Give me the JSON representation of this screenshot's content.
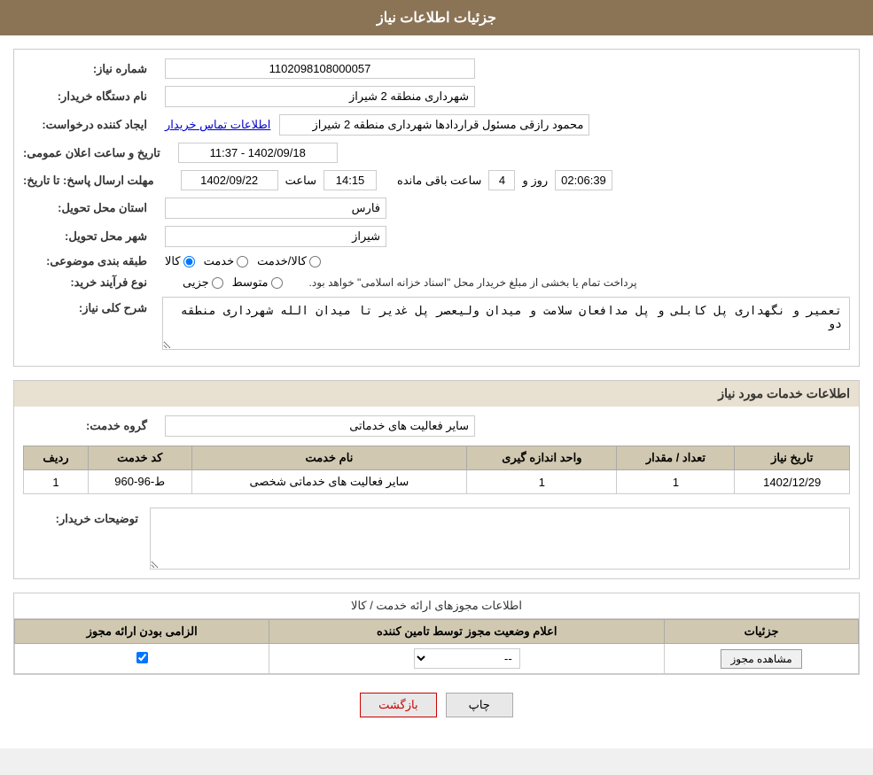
{
  "header": {
    "title": "جزئیات اطلاعات نیاز"
  },
  "labels": {
    "order_number": "شماره نیاز:",
    "buyer_org": "نام دستگاه خریدار:",
    "requester": "ایجاد کننده درخواست:",
    "response_deadline": "مهلت ارسال پاسخ: تا تاریخ:",
    "delivery_province": "استان محل تحویل:",
    "delivery_city": "شهر محل تحویل:",
    "category": "طبقه بندی موضوعی:",
    "purchase_type": "نوع فرآیند خرید:",
    "general_desc": "شرح کلی نیاز:",
    "service_info": "اطلاعات خدمات مورد نیاز",
    "service_group": "گروه خدمت:",
    "buyer_notes": "توضیحات خریدار:",
    "license_info": "اطلاعات مجوزهای ارائه خدمت / کالا",
    "contact_info": "اطلاعات تماس خریدار"
  },
  "values": {
    "order_number": "1102098108000057",
    "buyer_org": "شهرداری منطقه 2 شیراز",
    "requester": "محمود رازقی مسئول قراردادها شهرداری منطقه 2 شیراز",
    "announce_date_label": "تاریخ و ساعت اعلان عمومی:",
    "announce_date": "1402/09/18 - 11:37",
    "response_date": "1402/09/22",
    "response_time": "14:15",
    "response_days": "4",
    "response_hours": "02:06:39",
    "delivery_province": "فارس",
    "delivery_city": "شیراز",
    "category_goods": "کالا",
    "category_service": "خدمت",
    "category_goods_service": "کالا/خدمت",
    "purchase_partial": "جزیی",
    "purchase_medium": "متوسط",
    "purchase_note": "پرداخت تمام یا بخشی از مبلغ خریدار محل \"اسناد خزانه اسلامی\" خواهد بود.",
    "general_desc_text": "تعمیر و نگهداری پل کابلی و پل مدافعان سلامت و میدان ولیعصر پل غدیر تا میدان الله شهرداری منطقه دو",
    "service_group_value": "سایر فعالیت های خدماتی",
    "table_headers": {
      "row": "ردیف",
      "code": "کد خدمت",
      "name": "نام خدمت",
      "unit": "واحد اندازه گیری",
      "quantity": "تعداد / مقدار",
      "date": "تاریخ نیاز"
    },
    "table_rows": [
      {
        "row": "1",
        "code": "ط-96-960",
        "name": "سایر فعالیت های خدماتی شخصی",
        "unit": "1",
        "quantity": "1",
        "date": "1402/12/29"
      }
    ],
    "license_table_headers": {
      "mandatory": "الزامی بودن ارائه مجوز",
      "status": "اعلام وضعیت مجوز توسط تامین کننده",
      "details": "جزئیات"
    },
    "license_rows": [
      {
        "mandatory": true,
        "status": "--",
        "view_btn": "مشاهده مجوز"
      }
    ],
    "status_options": [
      "--"
    ],
    "buttons": {
      "print": "چاپ",
      "back": "بازگشت"
    },
    "days_label": "روز و",
    "hours_label": "ساعت باقی مانده"
  }
}
